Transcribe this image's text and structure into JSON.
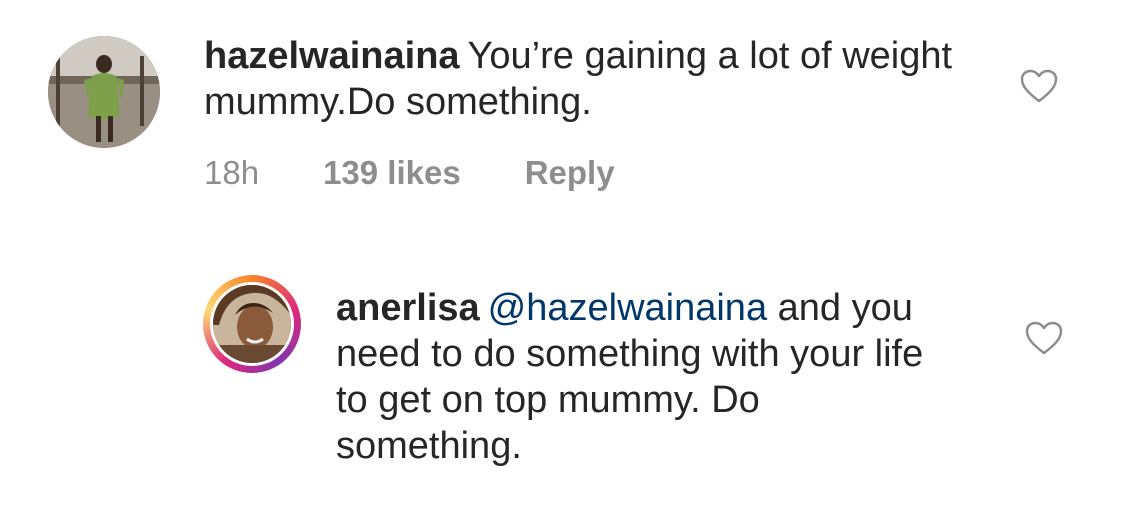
{
  "comments": [
    {
      "username": "hazelwainaina",
      "text": "You’re gaining a lot of weight mummy.Do something.",
      "time": "18h",
      "likes": "139 likes",
      "reply_label": "Reply",
      "like_icon": "heart-outline-icon"
    },
    {
      "username": "anerlisa",
      "mention": "@hazelwainaina",
      "text": "and you need to do something with your life to get on top mummy. Do something.",
      "like_icon": "heart-outline-icon"
    }
  ],
  "colors": {
    "text": "#262626",
    "secondary": "#8e8e8e",
    "mention": "#00376b"
  }
}
